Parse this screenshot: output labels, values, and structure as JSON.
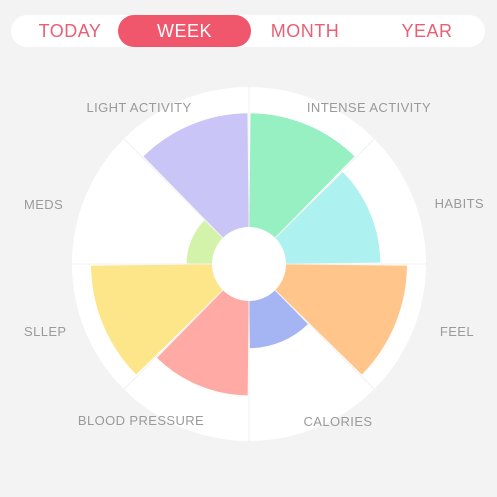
{
  "tabs": {
    "items": [
      {
        "id": "today",
        "label": "TODAY",
        "active": false
      },
      {
        "id": "week",
        "label": "WEEK",
        "active": true
      },
      {
        "id": "month",
        "label": "MONTH",
        "active": false
      },
      {
        "id": "year",
        "label": "YEAR",
        "active": false
      }
    ],
    "active_color": "#f0566c",
    "text_color": "#e95f73"
  },
  "chart_data": {
    "type": "polar-area",
    "scale_max": 1.0,
    "categories": [
      {
        "label": "INTENSE ACTIVITY",
        "value": 0.94,
        "color": "#96f0c1"
      },
      {
        "label": "HABITS",
        "value": 0.78,
        "color": "#adf2f0"
      },
      {
        "label": "FEEL",
        "value": 1.0,
        "color": "#ffc58a"
      },
      {
        "label": "CALORIES",
        "value": 0.39,
        "color": "#a5b5f4"
      },
      {
        "label": "BLOOD PRESSURE",
        "value": 0.78,
        "color": "#ffaaa5"
      },
      {
        "label": "SLLEP",
        "value": 1.0,
        "color": "#fde68a"
      },
      {
        "label": "MEDS",
        "value": 0.21,
        "color": "#d3f2aa"
      },
      {
        "label": "LIGHT ACTIVITY",
        "value": 0.94,
        "color": "#c9c5f7"
      }
    ]
  }
}
